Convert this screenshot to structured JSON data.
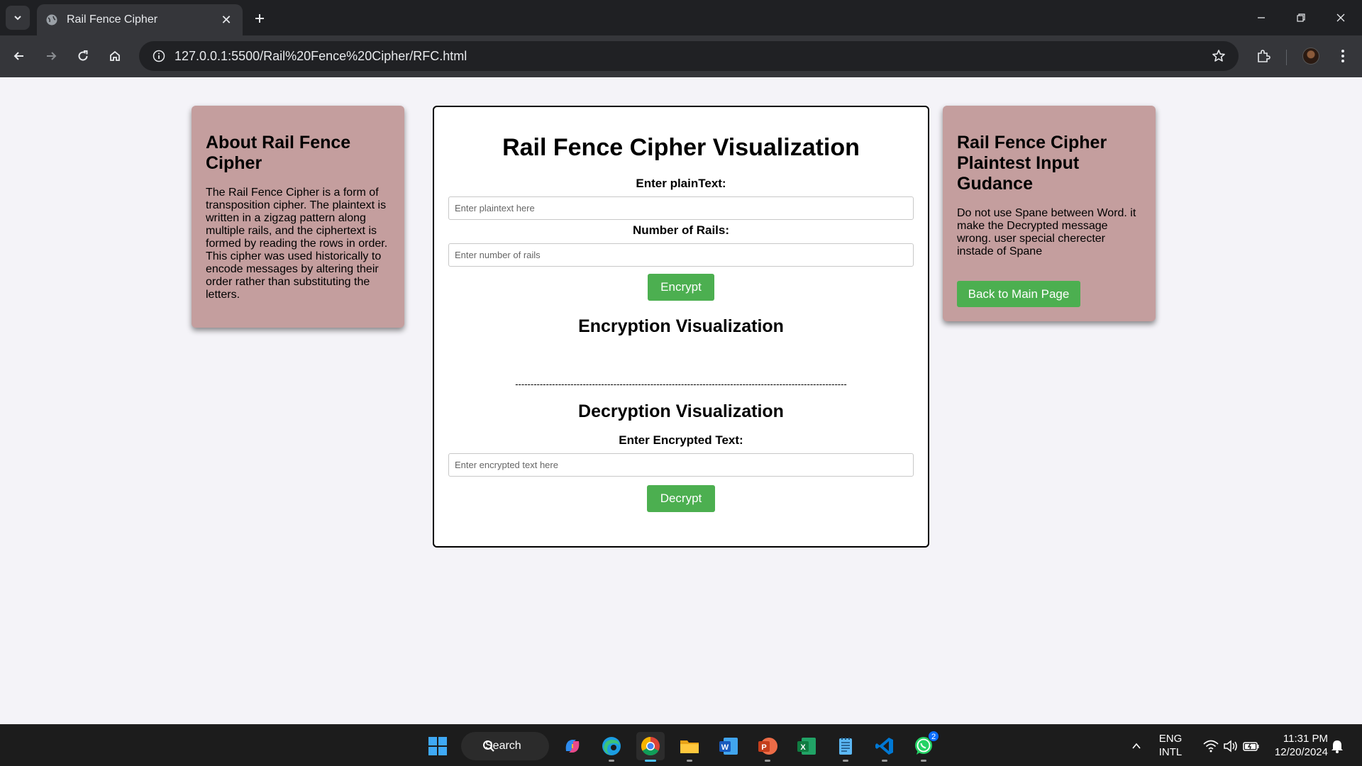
{
  "browser": {
    "tab_title": "Rail Fence Cipher",
    "url": "127.0.0.1:5500/Rail%20Fence%20Cipher/RFC.html"
  },
  "about": {
    "heading": "About Rail Fence Cipher",
    "body": "The Rail Fence Cipher is a form of transposition cipher. The plaintext is written in a zigzag pattern along multiple rails, and the ciphertext is formed by reading the rows in order. This cipher was used historically to encode messages by altering their order rather than substituting the letters."
  },
  "guide": {
    "heading": "Rail Fence Cipher Plaintest Input Gudance",
    "body": "Do not use Spane between Word. it make the Decrypted message wrong. user special cherecter instade of Spane",
    "back_button": "Back to Main Page"
  },
  "main": {
    "title": "Rail Fence Cipher Visualization",
    "plaintext_label": "Enter plainText:",
    "plaintext_placeholder": "Enter plaintext here",
    "plaintext_value": "",
    "rails_label": "Number of Rails:",
    "rails_placeholder": "Enter number of rails",
    "rails_value": "",
    "encrypt_button": "Encrypt",
    "encryption_heading": "Encryption Visualization",
    "divider": "------------------------------------------------------------------------------------------------------------",
    "decryption_heading": "Decryption Visualization",
    "encrypted_label": "Enter Encrypted Text:",
    "encrypted_placeholder": "Enter encrypted text here",
    "encrypted_value": "",
    "decrypt_button": "Decrypt"
  },
  "taskbar": {
    "search_label": "Search",
    "lang_line1": "ENG",
    "lang_line2": "INTL",
    "time": "11:31 PM",
    "date": "12/20/2024",
    "whatsapp_badge": "2",
    "pinned": [
      "start-icon",
      "copilot-icon",
      "edge-icon",
      "chrome-icon",
      "file-explorer-icon",
      "word-icon",
      "powerpoint-icon",
      "excel-icon",
      "notepad-icon",
      "vscode-icon",
      "whatsapp-icon"
    ]
  },
  "colors": {
    "side_card": "#c49e9e",
    "button_green": "#4caf50",
    "page_bg": "#f4f3f8",
    "chrome_dark": "#35363a"
  }
}
